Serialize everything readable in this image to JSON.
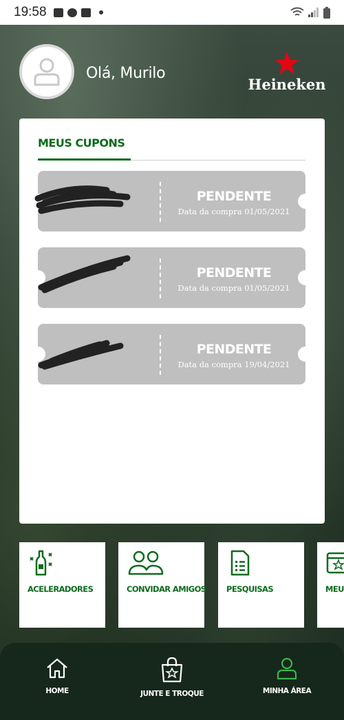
{
  "status_bar": {
    "time": "19:58"
  },
  "header": {
    "greeting": "Olá, Murilo",
    "brand": "Heineken"
  },
  "coupons_card": {
    "title": "MEUS CUPONS",
    "coupons": [
      {
        "status": "PENDENTE",
        "date": "Data da compra 01/05/2021"
      },
      {
        "status": "PENDENTE",
        "date": "Data da compra 01/05/2021"
      },
      {
        "status": "PENDENTE",
        "date": "Data da compra 19/04/2021"
      }
    ]
  },
  "tiles": [
    {
      "label": "ACELERADORES",
      "icon": "bottle-icon"
    },
    {
      "label": "CONVIDAR AMIGOS",
      "icon": "people-icon"
    },
    {
      "label": "PESQUISAS",
      "icon": "survey-icon"
    },
    {
      "label": "MEUS",
      "icon": "star-card-icon"
    }
  ],
  "bottom_nav": {
    "items": [
      {
        "label": "HOME",
        "icon": "home-icon"
      },
      {
        "label": "JUNTE E TROQUE",
        "icon": "shopping-bag-icon"
      },
      {
        "label": "MINHA ÁREA",
        "icon": "user-icon",
        "active": true
      }
    ]
  },
  "colors": {
    "accent": "#0d6b1d",
    "coupon_bg": "#bfbfbf",
    "nav_bg": "#16271b",
    "active_icon": "#3cb54a"
  }
}
